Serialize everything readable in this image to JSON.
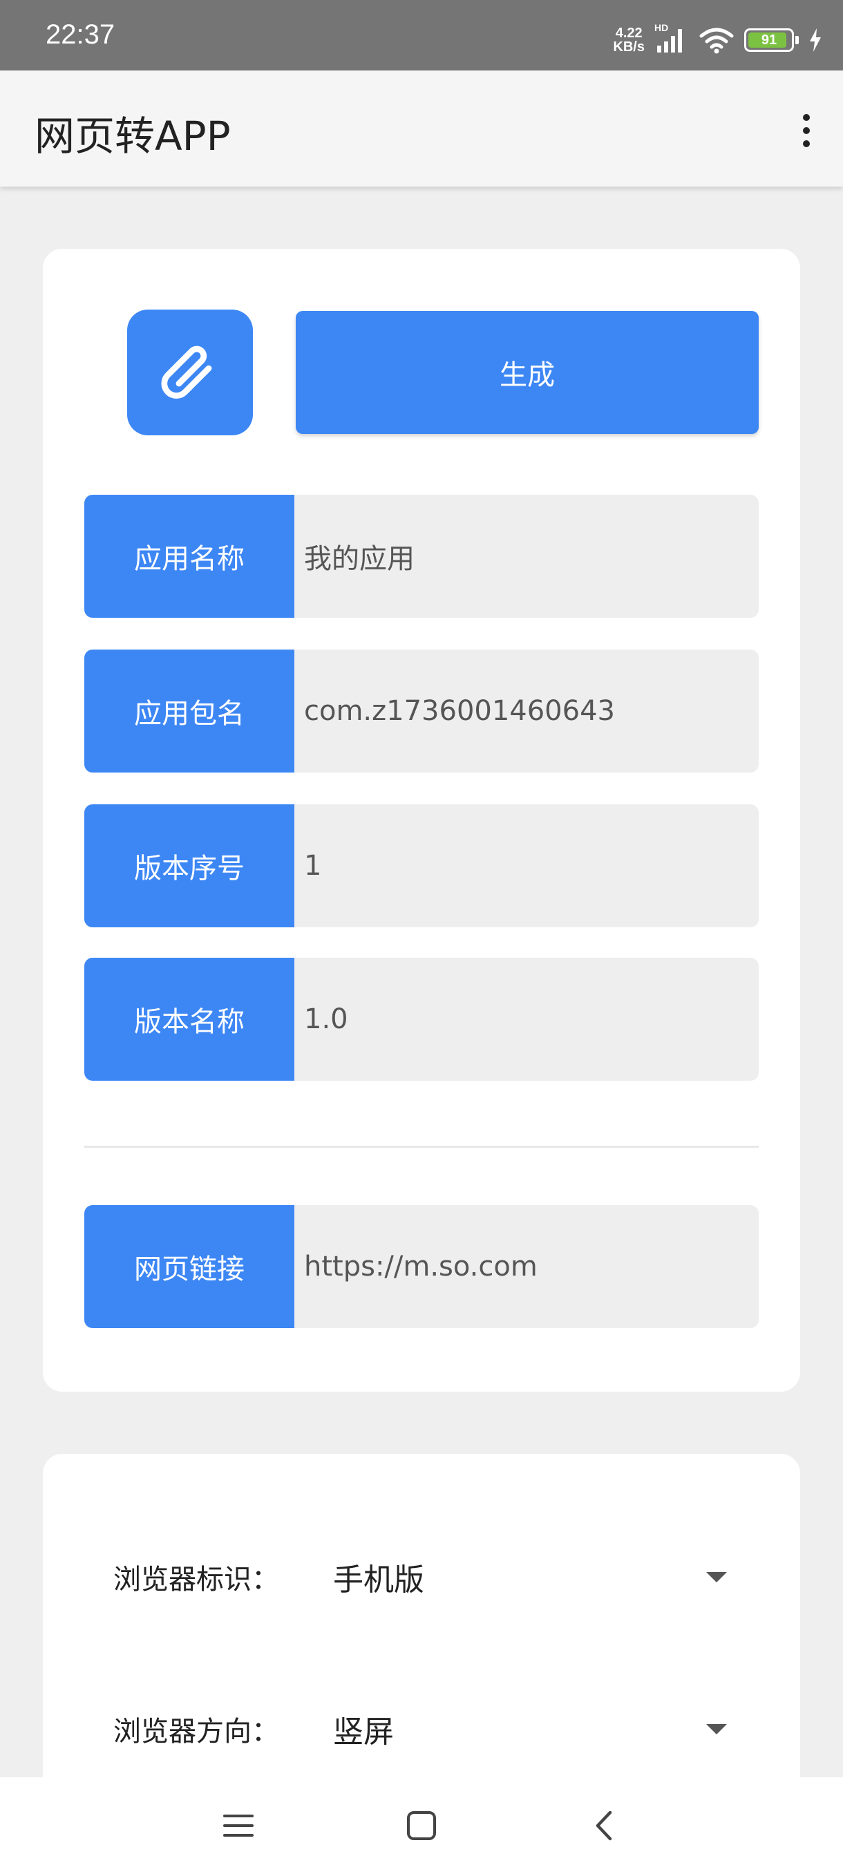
{
  "status_bar": {
    "time": "22:37",
    "net_speed_value": "4.22",
    "net_speed_unit": "KB/s",
    "network_badge": "HD",
    "battery_level": "91",
    "battery_fraction": 0.91,
    "icons": [
      "signal-icon",
      "wifi-icon",
      "battery-icon",
      "charging-icon"
    ]
  },
  "app_bar": {
    "title": "网页转APP",
    "menu_icon": "more-vert-icon"
  },
  "form": {
    "icon_button": "paperclip-icon",
    "generate_label": "生成",
    "fields": [
      {
        "label": "应用名称",
        "value": "我的应用"
      },
      {
        "label": "应用包名",
        "value": "com.z1736001460643"
      },
      {
        "label": "版本序号",
        "value": "1"
      },
      {
        "label": "版本名称",
        "value": "1.0"
      }
    ],
    "url_field": {
      "label": "网页链接",
      "value": "https://m.so.com"
    }
  },
  "settings": {
    "browser_ua": {
      "label": "浏览器标识：",
      "value": "手机版"
    },
    "browser_orientation": {
      "label": "浏览器方向：",
      "value": "竖屏"
    }
  },
  "nav_bar": {
    "icons": [
      "menu-icon",
      "home-icon",
      "back-icon"
    ]
  },
  "colors": {
    "accent": "#3d87f5",
    "status_bar": "#757575",
    "background": "#efefef",
    "battery": "#7cc242"
  }
}
